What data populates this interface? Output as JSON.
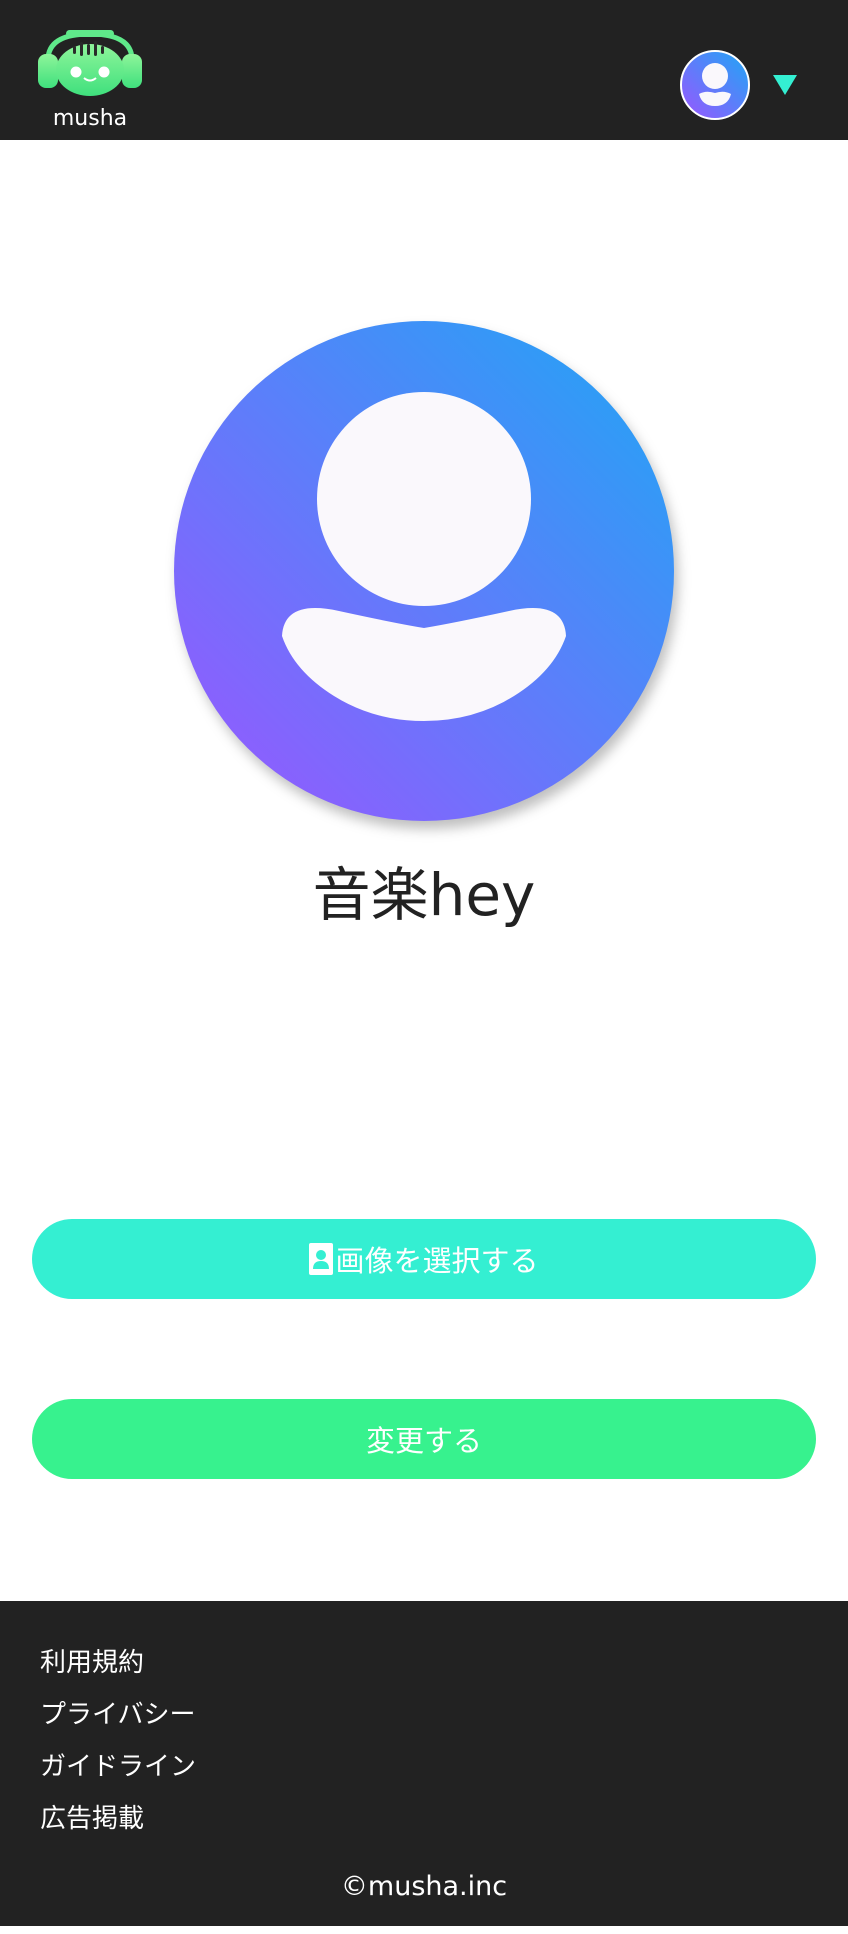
{
  "header": {
    "logo_text": "musha",
    "avatar_icon": "user-avatar-icon",
    "menu_icon": "caret-down-icon"
  },
  "profile": {
    "avatar_icon": "user-avatar-icon",
    "username": "音楽hey"
  },
  "actions": {
    "select_image_label": "画像を選択する",
    "select_image_icon": "contact-card-icon",
    "change_label": "変更する"
  },
  "footer": {
    "links": [
      {
        "label": "利用規約"
      },
      {
        "label": "プライバシー"
      },
      {
        "label": "ガイドライン"
      },
      {
        "label": "広告掲載"
      }
    ],
    "copyright": "©musha.inc"
  },
  "colors": {
    "header_bg": "#222222",
    "select_button": "#34efd2",
    "change_button": "#37f28e",
    "avatar_gradient_start": "#1ea7f5",
    "avatar_gradient_end": "#9b55ff",
    "caret": "#34efd2"
  }
}
